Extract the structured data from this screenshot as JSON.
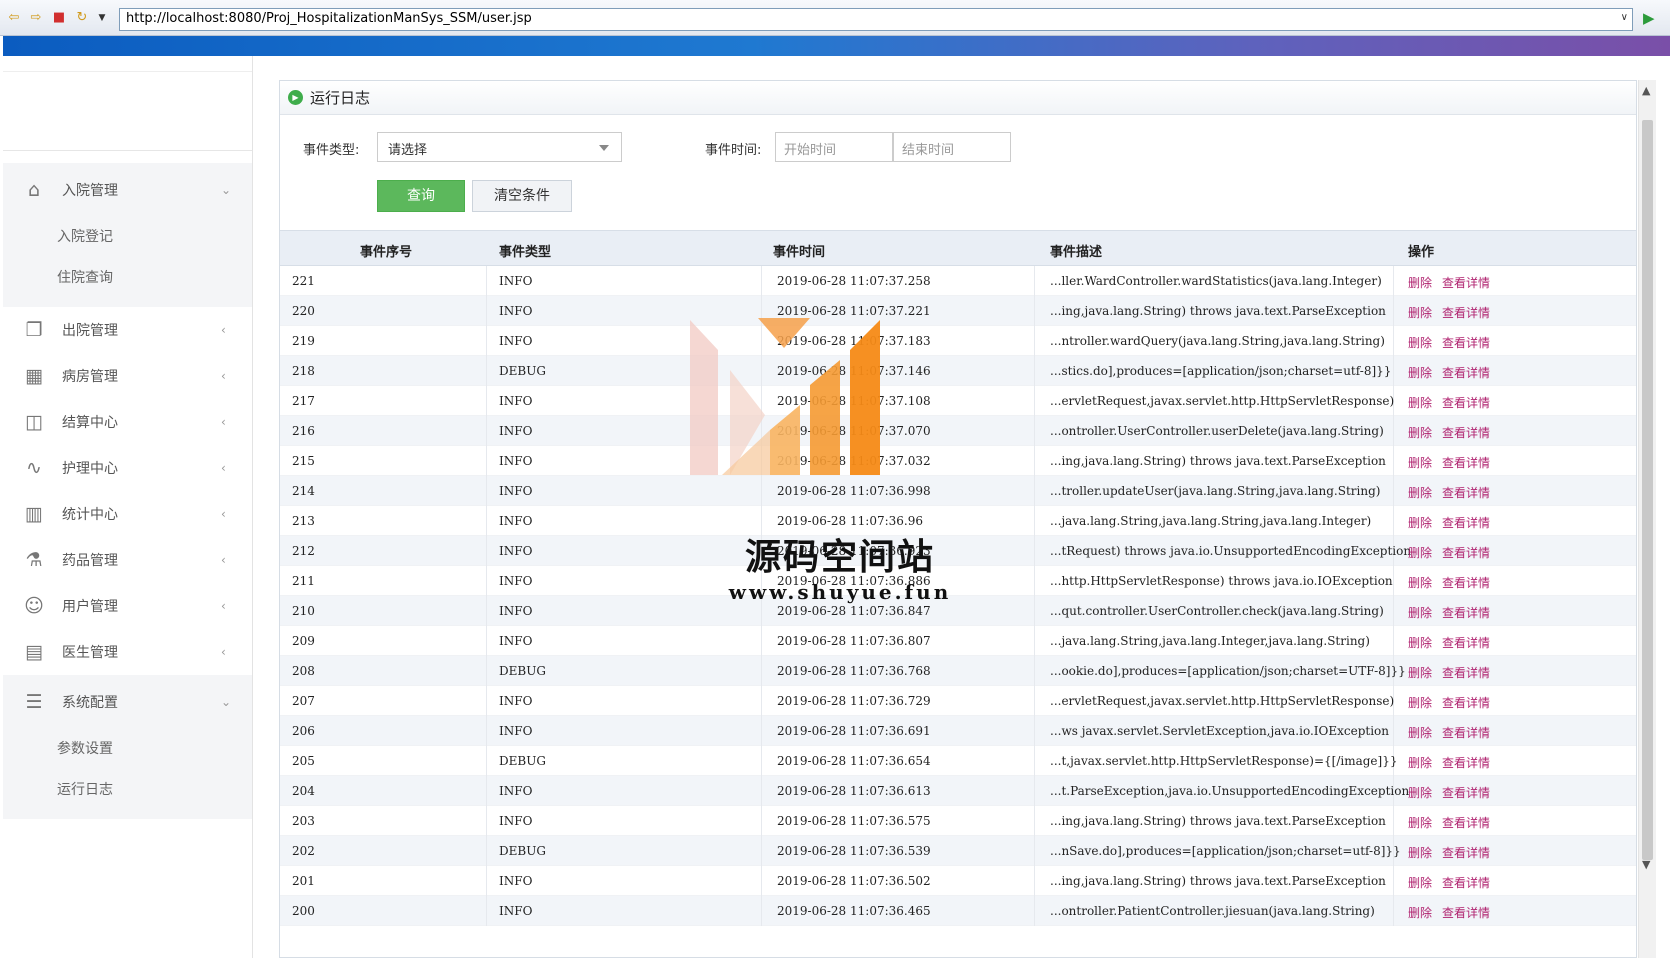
{
  "browser": {
    "url": "http://localhost:8080/Proj_HospitalizationManSys_SSM/user.jsp"
  },
  "sidebar": {
    "groups": [
      {
        "label": "入院管理",
        "icon": "home-icon",
        "expanded": true,
        "items": [
          "入院登记",
          "住院查询"
        ]
      },
      {
        "label": "出院管理",
        "icon": "window-icon",
        "expanded": false
      },
      {
        "label": "病房管理",
        "icon": "building-icon",
        "expanded": false
      },
      {
        "label": "结算中心",
        "icon": "map-icon",
        "expanded": false
      },
      {
        "label": "护理中心",
        "icon": "pulse-icon",
        "expanded": false
      },
      {
        "label": "统计中心",
        "icon": "bar-chart-icon",
        "expanded": false
      },
      {
        "label": "药品管理",
        "icon": "flask-icon",
        "expanded": false
      },
      {
        "label": "用户管理",
        "icon": "user-icon",
        "expanded": false
      },
      {
        "label": "医生管理",
        "icon": "id-card-icon",
        "expanded": false
      },
      {
        "label": "系统配置",
        "icon": "list-icon",
        "expanded": true,
        "items": [
          "参数设置",
          "运行日志"
        ]
      }
    ]
  },
  "panel": {
    "title": "运行日志"
  },
  "filter": {
    "type_label": "事件类型:",
    "type_value": "请选择",
    "time_label": "事件时间:",
    "start_placeholder": "开始时间",
    "end_placeholder": "结束时间",
    "separator": "-",
    "query_btn": "查询",
    "clear_btn": "清空条件"
  },
  "table": {
    "headers": [
      "事件序号",
      "事件类型",
      "事件时间",
      "事件描述",
      "操作"
    ],
    "action_delete": "删除",
    "action_view": "查看详情",
    "rows": [
      {
        "id": "221",
        "type": "INFO",
        "time": "2019-06-28 11:07:37.258",
        "desc": "...ller.WardController.wardStatistics(java.lang.Integer)"
      },
      {
        "id": "220",
        "type": "INFO",
        "time": "2019-06-28 11:07:37.221",
        "desc": "...ing,java.lang.String) throws java.text.ParseException"
      },
      {
        "id": "219",
        "type": "INFO",
        "time": "2019-06-28 11:07:37.183",
        "desc": "...ntroller.wardQuery(java.lang.String,java.lang.String)"
      },
      {
        "id": "218",
        "type": "DEBUG",
        "time": "2019-06-28 11:07:37.146",
        "desc": "...stics.do],produces=[application/json;charset=utf-8]}}"
      },
      {
        "id": "217",
        "type": "INFO",
        "time": "2019-06-28 11:07:37.108",
        "desc": "...ervletRequest,javax.servlet.http.HttpServletResponse)"
      },
      {
        "id": "216",
        "type": "INFO",
        "time": "2019-06-28 11:07:37.070",
        "desc": "...ontroller.UserController.userDelete(java.lang.String)"
      },
      {
        "id": "215",
        "type": "INFO",
        "time": "2019-06-28 11:07:37.032",
        "desc": "...ing,java.lang.String) throws java.text.ParseException"
      },
      {
        "id": "214",
        "type": "INFO",
        "time": "2019-06-28 11:07:36.998",
        "desc": "...troller.updateUser(java.lang.String,java.lang.String)"
      },
      {
        "id": "213",
        "type": "INFO",
        "time": "2019-06-28 11:07:36.96",
        "desc": "...java.lang.String,java.lang.String,java.lang.Integer)"
      },
      {
        "id": "212",
        "type": "INFO",
        "time": "2019-06-28 11:07:36.923",
        "desc": "...tRequest) throws java.io.UnsupportedEncodingException"
      },
      {
        "id": "211",
        "type": "INFO",
        "time": "2019-06-28 11:07:36.886",
        "desc": "...http.HttpServletResponse) throws java.io.IOException"
      },
      {
        "id": "210",
        "type": "INFO",
        "time": "2019-06-28 11:07:36.847",
        "desc": "...qut.controller.UserController.check(java.lang.String)"
      },
      {
        "id": "209",
        "type": "INFO",
        "time": "2019-06-28 11:07:36.807",
        "desc": "...java.lang.String,java.lang.Integer,java.lang.String)"
      },
      {
        "id": "208",
        "type": "DEBUG",
        "time": "2019-06-28 11:07:36.768",
        "desc": "...ookie.do],produces=[application/json;charset=UTF-8]}}"
      },
      {
        "id": "207",
        "type": "INFO",
        "time": "2019-06-28 11:07:36.729",
        "desc": "...ervletRequest,javax.servlet.http.HttpServletResponse)"
      },
      {
        "id": "206",
        "type": "INFO",
        "time": "2019-06-28 11:07:36.691",
        "desc": "...ws javax.servlet.ServletException,java.io.IOException"
      },
      {
        "id": "205",
        "type": "DEBUG",
        "time": "2019-06-28 11:07:36.654",
        "desc": "...t,javax.servlet.http.HttpServletResponse)={[/image]}}"
      },
      {
        "id": "204",
        "type": "INFO",
        "time": "2019-06-28 11:07:36.613",
        "desc": "...t.ParseException,java.io.UnsupportedEncodingException"
      },
      {
        "id": "203",
        "type": "INFO",
        "time": "2019-06-28 11:07:36.575",
        "desc": "...ing,java.lang.String) throws java.text.ParseException"
      },
      {
        "id": "202",
        "type": "DEBUG",
        "time": "2019-06-28 11:07:36.539",
        "desc": "...nSave.do],produces=[application/json;charset=utf-8]}}"
      },
      {
        "id": "201",
        "type": "INFO",
        "time": "2019-06-28 11:07:36.502",
        "desc": "...ing,java.lang.String) throws java.text.ParseException"
      },
      {
        "id": "200",
        "type": "INFO",
        "time": "2019-06-28 11:07:36.465",
        "desc": "...ontroller.PatientController.jiesuan(java.lang.String)"
      }
    ]
  },
  "watermark": {
    "title": "源码空间站",
    "url": "www.shuyue.fun"
  }
}
